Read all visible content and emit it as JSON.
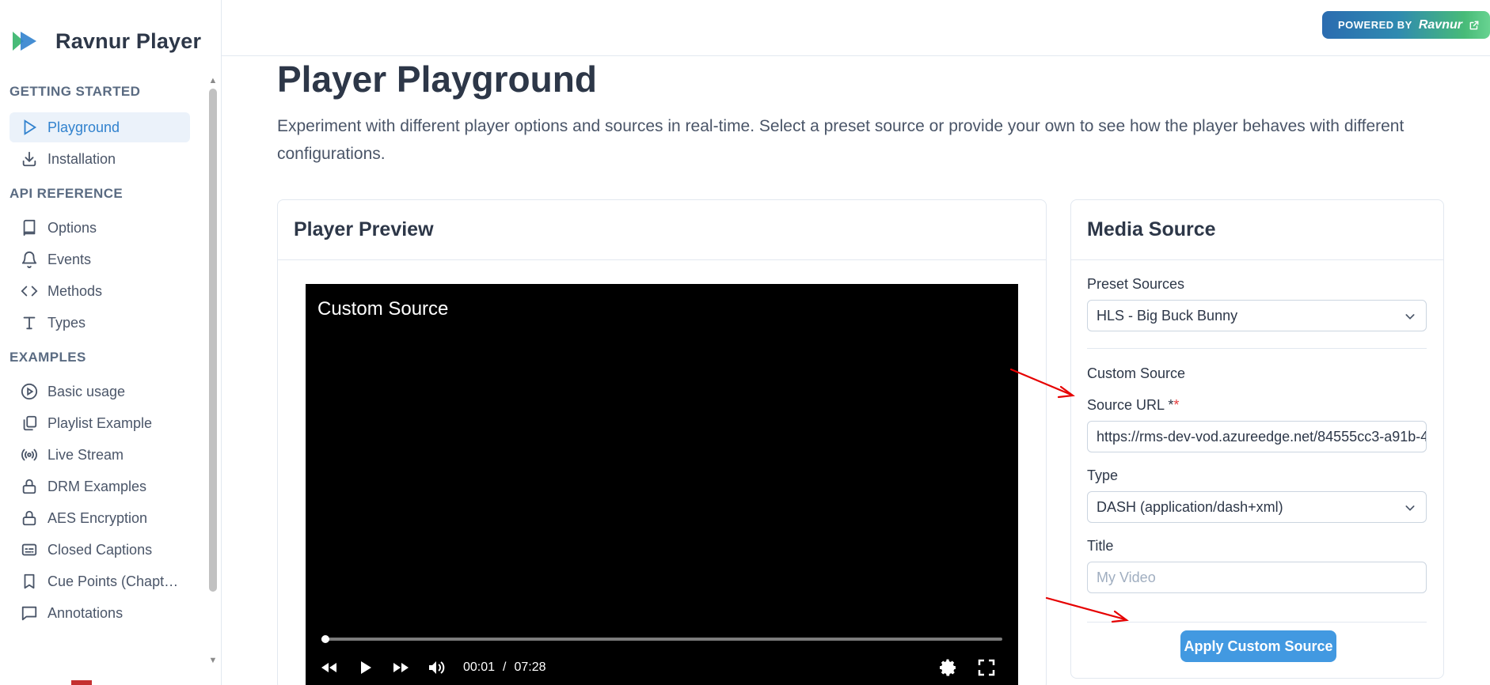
{
  "app": {
    "name": "Ravnur Player"
  },
  "topbar": {
    "powered_small": "POWERED BY",
    "powered_brand": "Ravnur"
  },
  "sidebar": {
    "sections": [
      {
        "title": "GETTING STARTED",
        "items": [
          {
            "label": "Playground",
            "icon": "play-outline-icon",
            "active": true
          },
          {
            "label": "Installation",
            "icon": "download-icon"
          }
        ]
      },
      {
        "title": "API REFERENCE",
        "items": [
          {
            "label": "Options",
            "icon": "book-icon"
          },
          {
            "label": "Events",
            "icon": "bell-icon"
          },
          {
            "label": "Methods",
            "icon": "code-icon"
          },
          {
            "label": "Types",
            "icon": "type-icon"
          }
        ]
      },
      {
        "title": "EXAMPLES",
        "items": [
          {
            "label": "Basic usage",
            "icon": "play-circle-icon"
          },
          {
            "label": "Playlist Example",
            "icon": "copy-icon"
          },
          {
            "label": "Live Stream",
            "icon": "radio-icon"
          },
          {
            "label": "DRM Examples",
            "icon": "lock-icon"
          },
          {
            "label": "AES Encryption",
            "icon": "lock-icon"
          },
          {
            "label": "Closed Captions",
            "icon": "captions-icon"
          },
          {
            "label": "Cue Points (Chapte...",
            "icon": "bookmark-icon"
          },
          {
            "label": "Annotations",
            "icon": "message-square-icon"
          }
        ]
      }
    ]
  },
  "main": {
    "title": "Player Playground",
    "description": "Experiment with different player options and sources in real-time. Select a preset source or provide your own to see how the player behaves with different configurations."
  },
  "preview": {
    "header": "Player Preview",
    "video_title": "Custom Source",
    "current_time": "00:01",
    "time_separator": "/",
    "duration": "07:28",
    "progress_fraction": 0.002
  },
  "media": {
    "header": "Media Source",
    "preset_label": "Preset Sources",
    "preset_value": "HLS - Big Buck Bunny",
    "custom_heading": "Custom Source",
    "url_label": "Source URL *",
    "url_required": "*",
    "url_value": "https://rms-dev-vod.azureedge.net/84555cc3-a91b-4",
    "type_label": "Type",
    "type_value": "DASH (application/dash+xml)",
    "title_label": "Title",
    "title_placeholder": "My Video",
    "apply_label": "Apply Custom Source"
  },
  "colors": {
    "accent": "#3182ce",
    "button": "#4299e1",
    "annotation_arrow": "#e60000"
  }
}
